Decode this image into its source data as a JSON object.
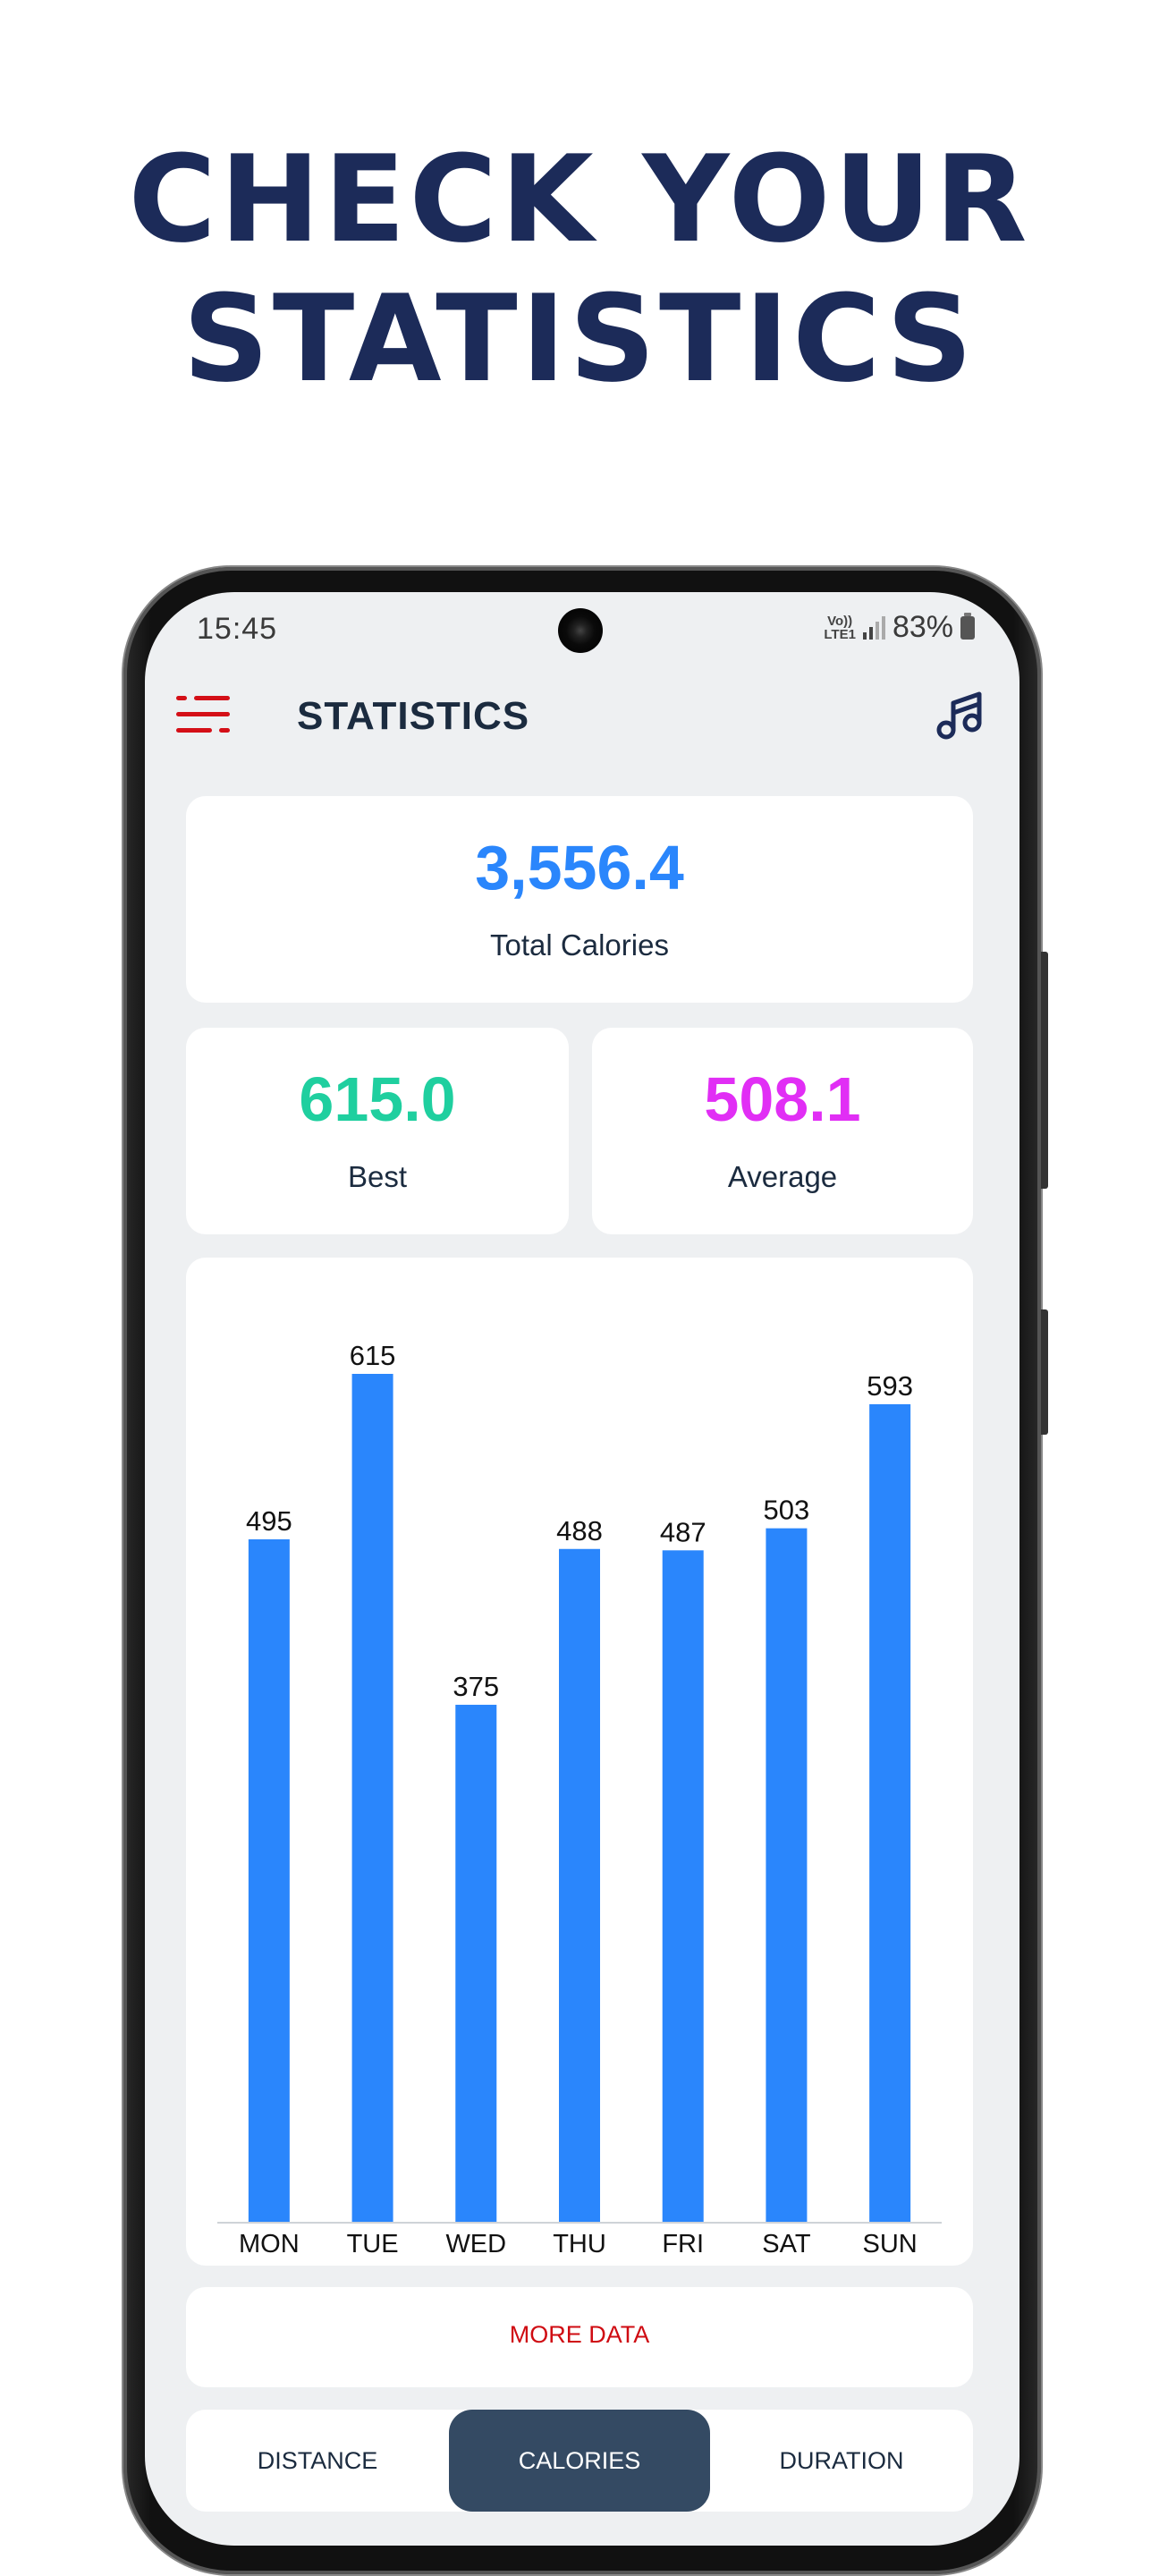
{
  "headline": {
    "line1": "CHECK YOUR",
    "line2": "STATISTICS"
  },
  "status_bar": {
    "time": "15:45",
    "network_top": "Vo))",
    "network_bottom": "LTE1",
    "battery_percent": "83%"
  },
  "toolbar": {
    "menu_icon": "menu-icon",
    "title": "STATISTICS",
    "music_icon": "music-note-icon"
  },
  "stats": {
    "total": {
      "value": "3,556.4",
      "label": "Total Calories",
      "color": "#2a86fc"
    },
    "best": {
      "value": "615.0",
      "label": "Best",
      "color": "#1fcf9f"
    },
    "average": {
      "value": "508.1",
      "label": "Average",
      "color": "#e12ef5"
    }
  },
  "chart_data": {
    "type": "bar",
    "title": "",
    "xlabel": "",
    "ylabel": "",
    "categories": [
      "MON",
      "TUE",
      "WED",
      "THU",
      "FRI",
      "SAT",
      "SUN"
    ],
    "values": [
      495,
      615,
      375,
      488,
      487,
      503,
      593
    ],
    "value_labels": [
      "495",
      "615",
      "375",
      "488",
      "487",
      "503",
      "593"
    ],
    "ylim": [
      0,
      615
    ],
    "grid": false,
    "legend": "none",
    "bar_color": "#2a86fc"
  },
  "more_data": {
    "label": "MORE DATA",
    "color": "#cf0b12"
  },
  "tabs": [
    {
      "label": "DISTANCE",
      "active": false
    },
    {
      "label": "CALORIES",
      "active": true
    },
    {
      "label": "DURATION",
      "active": false
    }
  ],
  "colors": {
    "headline": "#1c2b59",
    "menu_icon": "#d40f17",
    "active_tab": "#344a63",
    "screen_bg": "#eef0f2"
  }
}
